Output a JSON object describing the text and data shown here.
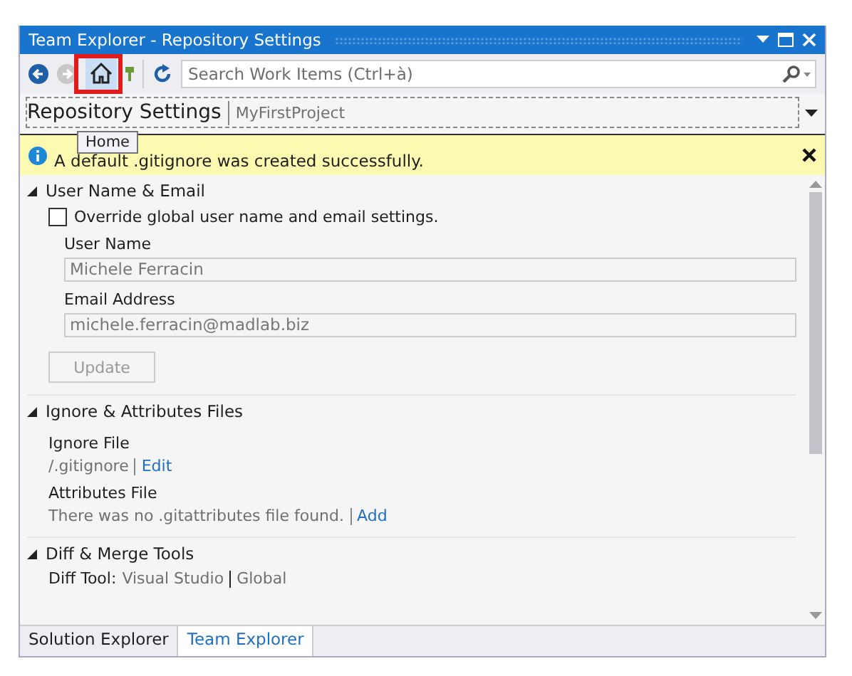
{
  "window": {
    "title": "Team Explorer - Repository Settings"
  },
  "toolbar": {
    "search": {
      "placeholder": "Search Work Items (Ctrl+à)"
    },
    "tooltip": "Home"
  },
  "page_header": {
    "title": "Repository Settings",
    "project": "MyFirstProject"
  },
  "info_bar": {
    "message": "A default .gitignore was created successfully."
  },
  "sections": [
    {
      "title": "User Name & Email",
      "expanded": true,
      "items": [
        {
          "kind": "checkbox",
          "label": "Override global user name and email settings.",
          "checked": false
        },
        {
          "kind": "field",
          "label": "User Name",
          "value": "Michele Ferracin",
          "disabled": true
        },
        {
          "kind": "field",
          "label": "Email Address",
          "value": "michele.ferracin@madlab.biz",
          "disabled": true
        },
        {
          "kind": "button",
          "label": "Update",
          "disabled": true
        }
      ]
    },
    {
      "title": "Ignore & Attributes Files",
      "expanded": true,
      "items": [
        {
          "kind": "file",
          "label": "Ignore File",
          "text": "/.gitignore",
          "link": "Edit"
        },
        {
          "kind": "file",
          "label": "Attributes File",
          "text": "There was no .gitattributes file found.",
          "link": "Add"
        }
      ]
    },
    {
      "title": "Diff & Merge Tools",
      "expanded": true,
      "items": [
        {
          "kind": "tool",
          "label": "Diff Tool:",
          "value": "Visual Studio",
          "scope": "Global"
        }
      ]
    }
  ],
  "bottom_tabs": [
    {
      "label": "Solution Explorer",
      "selected": false
    },
    {
      "label": "Team Explorer",
      "selected": true
    }
  ]
}
